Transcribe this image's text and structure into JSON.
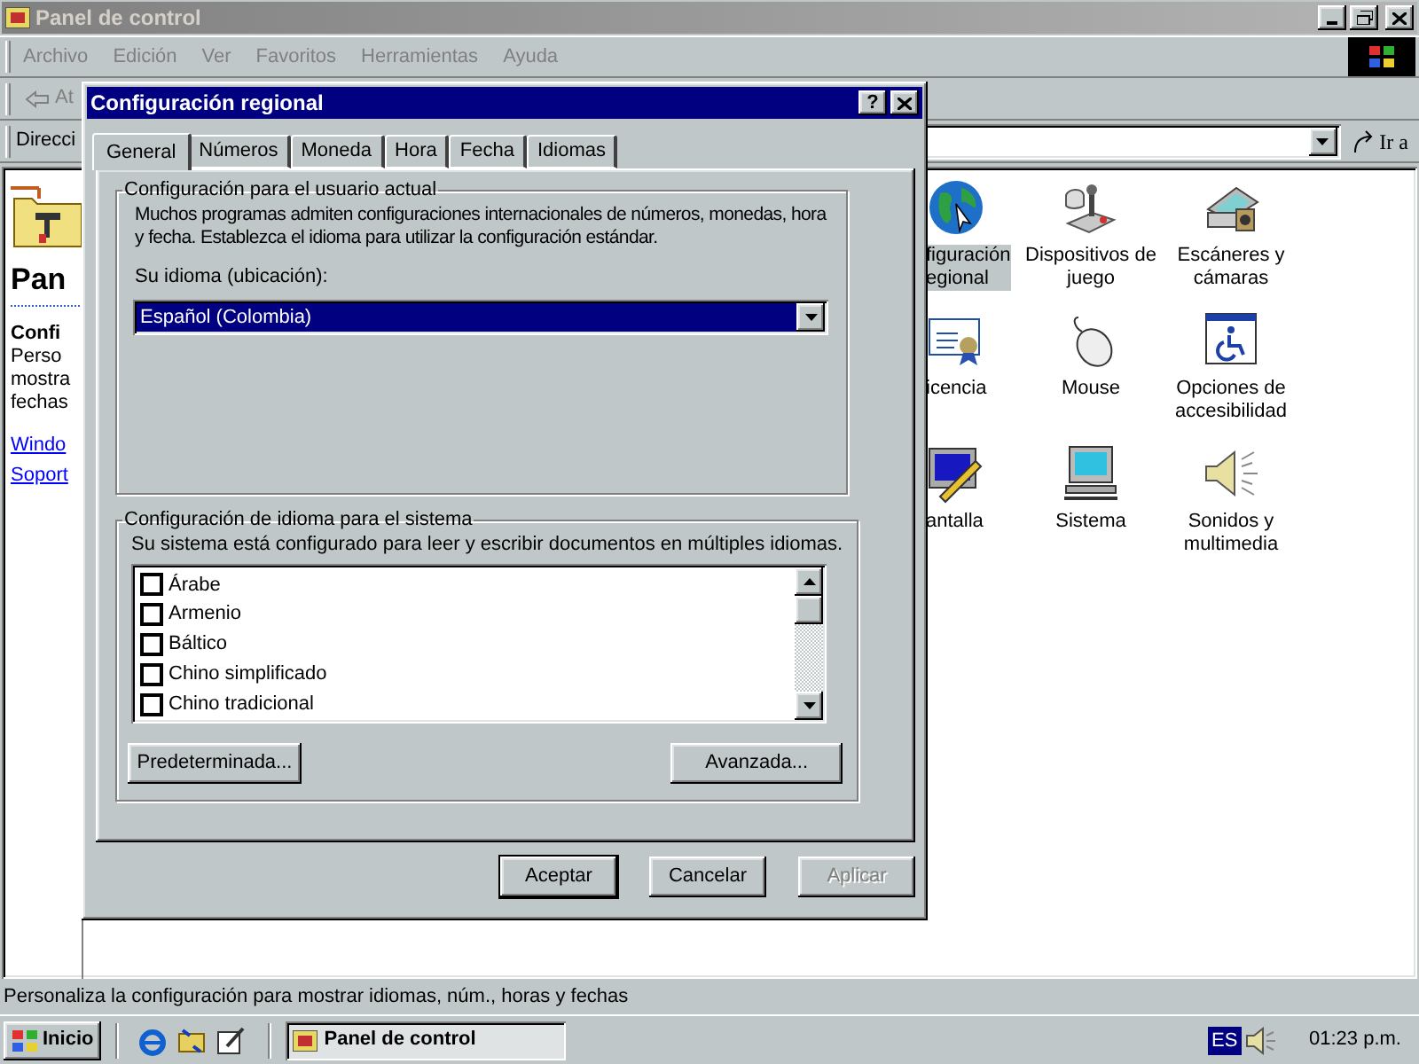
{
  "window": {
    "title": "Panel de control"
  },
  "menu": [
    "Archivo",
    "Edición",
    "Ver",
    "Favoritos",
    "Herramientas",
    "Ayuda"
  ],
  "toolbar": {
    "back_label": "At"
  },
  "address_bar": {
    "label": "Direcci",
    "go_label": "Ir a"
  },
  "left_panel": {
    "heading": "Pan",
    "subheading": "Confi",
    "description_lines": [
      "Perso",
      "mostra",
      "fechas"
    ],
    "links": [
      "Windo",
      "Soport"
    ]
  },
  "icons": [
    {
      "kind": "globe",
      "lines": [
        "figuración",
        "egional"
      ],
      "selected": true
    },
    {
      "kind": "joystick",
      "lines": [
        "Dispositivos de",
        "juego"
      ],
      "selected": false
    },
    {
      "kind": "scanner",
      "lines": [
        "Escáneres y",
        "cámaras"
      ],
      "selected": false
    },
    {
      "kind": "certificate",
      "lines": [
        "icencia"
      ],
      "selected": false
    },
    {
      "kind": "mouse",
      "lines": [
        "Mouse"
      ],
      "selected": false
    },
    {
      "kind": "accessibility",
      "lines": [
        "Opciones de",
        "accesibilidad"
      ],
      "selected": false
    },
    {
      "kind": "display",
      "lines": [
        "antalla"
      ],
      "selected": false
    },
    {
      "kind": "computer",
      "lines": [
        "Sistema"
      ],
      "selected": false
    },
    {
      "kind": "speaker",
      "lines": [
        "Sonidos y",
        "multimedia"
      ],
      "selected": false
    }
  ],
  "status_bar": "Personaliza la configuración para mostrar idiomas, núm., horas y fechas",
  "taskbar": {
    "start": "Inicio",
    "tasks": [
      {
        "label": "Panel de control",
        "selected": true
      }
    ],
    "language": "ES",
    "clock": "01:23 p.m."
  },
  "dialog": {
    "title": "Configuración regional",
    "help_button": "?",
    "tabs": [
      {
        "label": "General",
        "selected": true
      },
      {
        "label": "Números",
        "selected": false
      },
      {
        "label": "Moneda",
        "selected": false
      },
      {
        "label": "Hora",
        "selected": false
      },
      {
        "label": "Fecha",
        "selected": false
      },
      {
        "label": "Idiomas",
        "selected": false
      }
    ],
    "user_group": {
      "title": "Configuración para el usuario actual",
      "description": "Muchos programas admiten configuraciones internacionales de números, monedas, hora y fecha. Establezca el idioma para utilizar la configuración estándar.",
      "locale_label": "Su idioma (ubicación):",
      "locale_value": "Español (Colombia)"
    },
    "system_group": {
      "title": "Configuración de idioma para el sistema",
      "description": "Su sistema está configurado para leer y escribir documentos en múltiples idiomas.",
      "languages": [
        {
          "label": "Árabe",
          "checked": false
        },
        {
          "label": "Armenio",
          "checked": false
        },
        {
          "label": "Báltico",
          "checked": false
        },
        {
          "label": "Chino simplificado",
          "checked": false
        },
        {
          "label": "Chino tradicional",
          "checked": false
        }
      ],
      "buttons": [
        "Predeterminada...",
        "Avanzada..."
      ]
    },
    "buttons": [
      {
        "label": "Aceptar",
        "default": true,
        "disabled": false
      },
      {
        "label": "Cancelar",
        "default": false,
        "disabled": false
      },
      {
        "label": "Aplicar",
        "default": false,
        "disabled": true
      }
    ]
  }
}
